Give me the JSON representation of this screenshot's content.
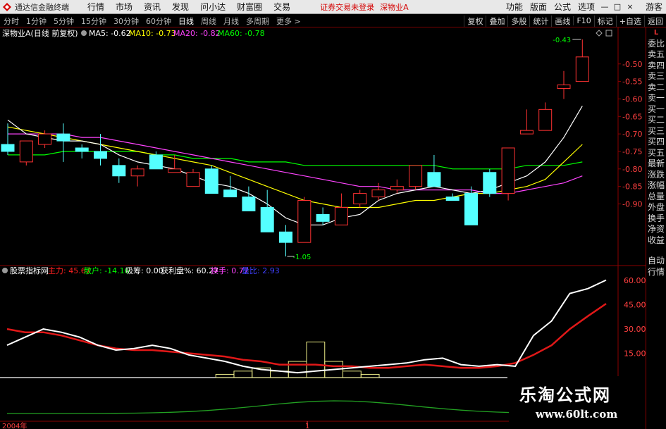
{
  "menubar": {
    "app_title": "通达信金融终端",
    "menus": [
      "行情",
      "市场",
      "资讯",
      "发现",
      "问小达",
      "财富圈",
      "交易"
    ],
    "notice": "证券交易未登录",
    "stock_name": "深物业A",
    "right_items": [
      "功能",
      "版面",
      "公式",
      "选项"
    ],
    "window_buttons": [
      "—",
      "□",
      "×"
    ],
    "user": "游客"
  },
  "toolbar": {
    "period_tabs": [
      "分时",
      "1分钟",
      "5分钟",
      "15分钟",
      "30分钟",
      "60分钟",
      "日线",
      "周线",
      "月线",
      "多周期",
      "更多 >"
    ],
    "active_tab": "日线",
    "right_buttons": [
      "复权",
      "叠加",
      "多股",
      "统计",
      "画线",
      "F10",
      "标记",
      "+自选",
      "返回"
    ]
  },
  "main_chart": {
    "title": "深物业A(日线 前复权)",
    "ma_labels": [
      {
        "text": "MA5: -0.62",
        "color": "#ffffff"
      },
      {
        "text": "MA10: -0.73",
        "color": "#ffff00"
      },
      {
        "text": "MA20: -0.82",
        "color": "#ff44ff"
      },
      {
        "text": "MA60: -0.78",
        "color": "#00ff00"
      }
    ],
    "y_ticks": [
      "-0.50",
      "-0.55",
      "-0.60",
      "-0.65",
      "-0.70",
      "-0.75",
      "-0.80",
      "-0.85",
      "-0.90"
    ],
    "high_label": "-0.43",
    "low_label": "-1.05",
    "colors": {
      "up": "#ff3232",
      "down": "#54ffff",
      "ma5": "#ffffff",
      "ma10": "#ffff00",
      "ma20": "#ff44ff",
      "ma60": "#00ff00",
      "axis": "#8b0000"
    }
  },
  "sub_chart": {
    "title": "股票指标网",
    "labels": [
      {
        "text": "主力: 45.67",
        "color": "#ff2020"
      },
      {
        "text": "散户: -14.16",
        "color": "#00ff00"
      },
      {
        "text": "吸筹: 0.00",
        "color": "#ffffff"
      },
      {
        "text": "获利盘%: 60.27",
        "color": "#ffffff"
      },
      {
        "text": "换手: 0.77",
        "color": "#ff44ff"
      },
      {
        "text": "量比: 2.93",
        "color": "#4040ff"
      }
    ],
    "y_ticks": [
      "60.00",
      "45.00",
      "30.00",
      "15.00"
    ]
  },
  "x_axis": {
    "start_label": "2004年",
    "mid_label": "1"
  },
  "side_panel": {
    "items": [
      "委比",
      "卖五",
      "卖四",
      "卖三",
      "卖二",
      "卖一",
      "买一",
      "买二",
      "买三",
      "买四",
      "买五",
      "最新",
      "涨跌",
      "涨幅",
      "总量",
      "外盘",
      "换手",
      "净资",
      "收益"
    ],
    "logo": "L",
    "bottom_items": [
      "自动",
      "行情"
    ]
  },
  "watermark": {
    "cn": "乐淘公式网",
    "url": "www.60lt.com"
  },
  "chart_data": {
    "type": "candlestick",
    "price_ylim": [
      -1.06,
      -0.42
    ],
    "candles": [
      {
        "o": -0.73,
        "c": -0.75,
        "h": -0.67,
        "l": -0.76
      },
      {
        "o": -0.78,
        "c": -0.72,
        "h": -0.72,
        "l": -0.79
      },
      {
        "o": -0.73,
        "c": -0.7,
        "h": -0.69,
        "l": -0.74
      },
      {
        "o": -0.7,
        "c": -0.72,
        "h": -0.67,
        "l": -0.78
      },
      {
        "o": -0.74,
        "c": -0.75,
        "h": -0.73,
        "l": -0.77
      },
      {
        "o": -0.75,
        "c": -0.77,
        "h": -0.7,
        "l": -0.79
      },
      {
        "o": -0.79,
        "c": -0.82,
        "h": -0.77,
        "l": -0.84
      },
      {
        "o": -0.82,
        "c": -0.8,
        "h": -0.79,
        "l": -0.85
      },
      {
        "o": -0.76,
        "c": -0.8,
        "h": -0.75,
        "l": -0.8
      },
      {
        "o": -0.81,
        "c": -0.8,
        "h": -0.76,
        "l": -0.81
      },
      {
        "o": -0.85,
        "c": -0.81,
        "h": -0.8,
        "l": -0.85
      },
      {
        "o": -0.8,
        "c": -0.87,
        "h": -0.79,
        "l": -0.87
      },
      {
        "o": -0.86,
        "c": -0.88,
        "h": -0.82,
        "l": -0.88
      },
      {
        "o": -0.88,
        "c": -0.92,
        "h": -0.85,
        "l": -0.92
      },
      {
        "o": -0.91,
        "c": -0.98,
        "h": -0.86,
        "l": -0.98
      },
      {
        "o": -0.98,
        "c": -1.01,
        "h": -0.96,
        "l": -1.05
      },
      {
        "o": -1.01,
        "c": -0.89,
        "h": -0.88,
        "l": -1.01
      },
      {
        "o": -0.93,
        "c": -0.95,
        "h": -0.91,
        "l": -0.96
      },
      {
        "o": -0.96,
        "c": -0.91,
        "h": -0.87,
        "l": -0.96
      },
      {
        "o": -0.9,
        "c": -0.87,
        "h": -0.86,
        "l": -0.91
      },
      {
        "o": -0.88,
        "c": -0.86,
        "h": -0.84,
        "l": -0.89
      },
      {
        "o": -0.86,
        "c": -0.85,
        "h": -0.83,
        "l": -0.87
      },
      {
        "o": -0.85,
        "c": -0.79,
        "h": -0.79,
        "l": -0.86
      },
      {
        "o": -0.81,
        "c": -0.85,
        "h": -0.76,
        "l": -0.85
      },
      {
        "o": -0.88,
        "c": -0.89,
        "h": -0.87,
        "l": -0.89
      },
      {
        "o": -0.87,
        "c": -0.96,
        "h": -0.85,
        "l": -0.96
      },
      {
        "o": -0.81,
        "c": -0.87,
        "h": -0.8,
        "l": -0.88
      },
      {
        "o": -0.87,
        "c": -0.74,
        "h": -0.74,
        "l": -0.89
      },
      {
        "o": -0.7,
        "c": -0.69,
        "h": -0.63,
        "l": -0.69
      },
      {
        "o": -0.69,
        "c": -0.63,
        "h": -0.61,
        "l": -0.69
      },
      {
        "o": -0.57,
        "c": -0.56,
        "h": -0.52,
        "l": -0.6
      },
      {
        "o": -0.55,
        "c": -0.48,
        "h": -0.43,
        "l": -0.55
      }
    ],
    "ma5": [
      -0.66,
      -0.7,
      -0.71,
      -0.72,
      -0.72,
      -0.73,
      -0.76,
      -0.78,
      -0.79,
      -0.8,
      -0.82,
      -0.84,
      -0.85,
      -0.87,
      -0.9,
      -0.94,
      -0.96,
      -0.96,
      -0.94,
      -0.93,
      -0.89,
      -0.87,
      -0.86,
      -0.85,
      -0.86,
      -0.87,
      -0.86,
      -0.84,
      -0.82,
      -0.78,
      -0.71,
      -0.62
    ],
    "ma10": [
      -0.68,
      -0.69,
      -0.7,
      -0.71,
      -0.72,
      -0.73,
      -0.74,
      -0.75,
      -0.76,
      -0.77,
      -0.78,
      -0.79,
      -0.81,
      -0.83,
      -0.85,
      -0.87,
      -0.89,
      -0.9,
      -0.91,
      -0.91,
      -0.91,
      -0.9,
      -0.89,
      -0.89,
      -0.88,
      -0.87,
      -0.87,
      -0.86,
      -0.85,
      -0.83,
      -0.78,
      -0.73
    ],
    "ma20": [
      -0.7,
      -0.7,
      -0.7,
      -0.7,
      -0.71,
      -0.71,
      -0.72,
      -0.73,
      -0.74,
      -0.75,
      -0.76,
      -0.77,
      -0.78,
      -0.79,
      -0.8,
      -0.81,
      -0.82,
      -0.83,
      -0.84,
      -0.85,
      -0.85,
      -0.86,
      -0.86,
      -0.86,
      -0.86,
      -0.86,
      -0.87,
      -0.87,
      -0.86,
      -0.85,
      -0.84,
      -0.82
    ],
    "ma60": [
      -0.76,
      -0.76,
      -0.76,
      -0.75,
      -0.75,
      -0.75,
      -0.75,
      -0.75,
      -0.76,
      -0.76,
      -0.77,
      -0.77,
      -0.77,
      -0.78,
      -0.78,
      -0.78,
      -0.79,
      -0.79,
      -0.79,
      -0.79,
      -0.79,
      -0.79,
      -0.79,
      -0.79,
      -0.8,
      -0.8,
      -0.8,
      -0.8,
      -0.79,
      -0.79,
      -0.79,
      -0.78
    ],
    "indicator_ylim": [
      0,
      64
    ],
    "main_force": [
      30,
      28,
      28,
      26,
      23,
      20,
      18,
      17,
      17,
      16,
      15,
      14,
      13,
      11,
      10,
      8,
      8,
      8,
      7,
      7,
      6,
      6,
      7,
      8,
      7,
      6,
      6,
      7,
      9,
      14,
      20,
      30,
      38,
      45.67
    ],
    "retail": [
      20,
      25,
      30,
      28,
      25,
      20,
      17,
      18,
      20,
      18,
      14,
      12,
      10,
      7,
      5,
      4,
      3,
      4,
      5,
      6,
      7,
      8,
      9,
      11,
      12,
      8,
      7,
      8,
      7,
      26,
      35,
      52,
      55,
      60.27
    ],
    "volume_bars": [
      0,
      0,
      0,
      0,
      0,
      0,
      0,
      0,
      0,
      0,
      0,
      0,
      2,
      4,
      6,
      4,
      10,
      22,
      10,
      4,
      2,
      0,
      0,
      0,
      0,
      0,
      0,
      0,
      0,
      0,
      0,
      0,
      0,
      0
    ]
  }
}
